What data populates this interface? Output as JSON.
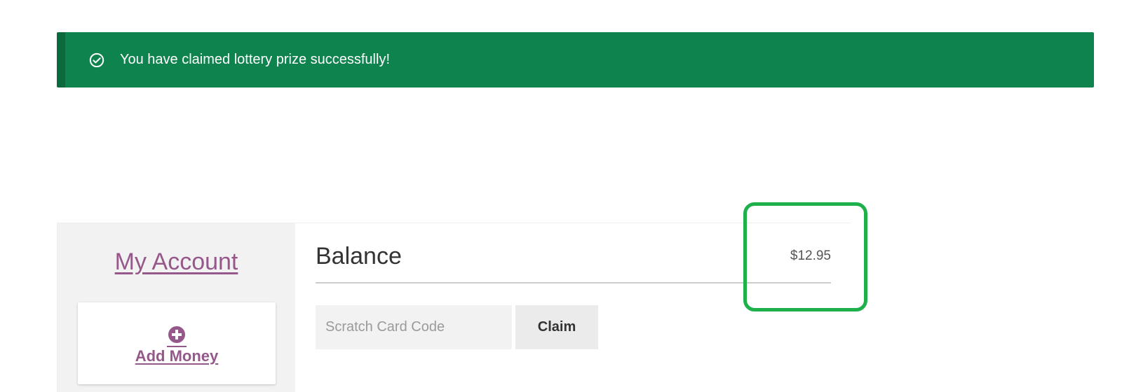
{
  "notice": {
    "message": "You have claimed lottery prize successfully!",
    "icon": "check-circle-icon",
    "color": "#0f834d"
  },
  "sidebar": {
    "title": "My Account",
    "add_money": {
      "label": "Add Money",
      "icon": "plus-circle-icon"
    }
  },
  "content": {
    "balance_label": "Balance",
    "balance_amount": "$12.95",
    "code_input": {
      "placeholder": "Scratch Card Code",
      "value": ""
    },
    "claim_label": "Claim"
  },
  "colors": {
    "accent": "#96588a",
    "highlight": "#1db04b"
  }
}
